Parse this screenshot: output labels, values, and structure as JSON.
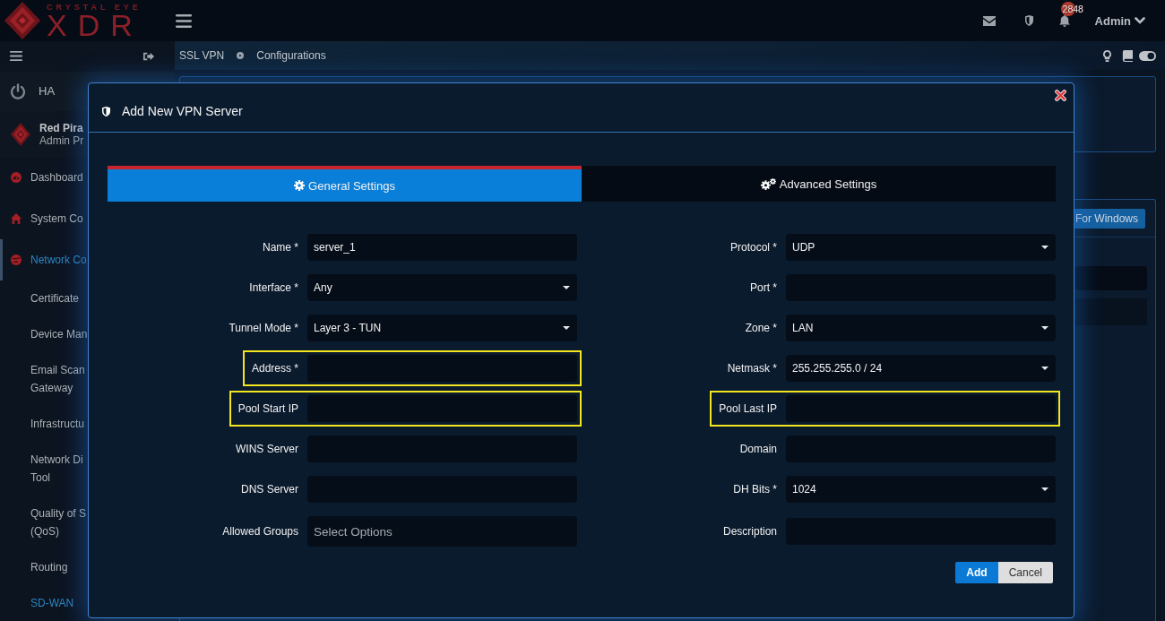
{
  "top_bar": {
    "logo": {
      "tagline": "CRYSTAL EYE",
      "wordmark": "XDR"
    },
    "notification_count": "2848",
    "user": "Admin"
  },
  "sidebar": {
    "status_item": "HA",
    "profile": {
      "name": "Red Pira",
      "role": "Admin Pr"
    },
    "items": [
      {
        "label": "Dashboard",
        "selected": false
      },
      {
        "label": "System Co",
        "selected": false
      },
      {
        "label": "Network Co",
        "selected": true,
        "children": [
          {
            "label": "Certificate",
            "selected": false
          },
          {
            "label": "Device Man",
            "selected": false
          },
          {
            "label": "Email Scan\nGateway",
            "selected": false
          },
          {
            "label": "Infrastructu",
            "selected": false
          },
          {
            "label": "Network Di\nTool",
            "selected": false
          },
          {
            "label": "Quality of S\n(QoS)",
            "selected": false
          },
          {
            "label": "Routing",
            "selected": false
          },
          {
            "label": "SD-WAN",
            "selected": true
          }
        ]
      }
    ]
  },
  "breadcrumb": [
    "SSL VPN",
    "Configurations"
  ],
  "page": {
    "download_button": "For Windows"
  },
  "modal": {
    "title": "Add New VPN Server",
    "tabs": [
      {
        "label": "General Settings",
        "selected": true
      },
      {
        "label": "Advanced Settings",
        "selected": false
      }
    ],
    "form": {
      "left_column": [
        {
          "label": "Name *",
          "kind": "text",
          "value": "server_1",
          "highlighted": false
        },
        {
          "label": "Interface *",
          "kind": "select",
          "value": "Any",
          "highlighted": false
        },
        {
          "label": "Tunnel Mode *",
          "kind": "select",
          "value": "Layer 3 - TUN",
          "highlighted": false
        },
        {
          "label": "Address *",
          "kind": "text",
          "highlighted": true
        },
        {
          "label": "Pool Start IP",
          "kind": "text",
          "highlighted": true
        },
        {
          "label": "WINS Server",
          "kind": "text",
          "highlighted": false
        },
        {
          "label": "DNS Server",
          "kind": "text",
          "highlighted": false
        },
        {
          "label": "Allowed Groups",
          "kind": "multiselect",
          "placeholder": "Select Options",
          "highlighted": false
        }
      ],
      "right_column": [
        {
          "label": "Protocol *",
          "kind": "select",
          "value": "UDP",
          "highlighted": false
        },
        {
          "label": "Port *",
          "kind": "text",
          "highlighted": false
        },
        {
          "label": "Zone *",
          "kind": "select",
          "value": "LAN",
          "highlighted": false
        },
        {
          "label": "Netmask *",
          "kind": "select",
          "value": "255.255.255.0 / 24",
          "highlighted": false
        },
        {
          "label": "Pool Last IP",
          "kind": "text",
          "highlighted": true
        },
        {
          "label": "Domain",
          "kind": "text",
          "highlighted": false
        },
        {
          "label": "DH Bits *",
          "kind": "select",
          "value": "1024",
          "highlighted": false
        },
        {
          "label": "Description",
          "kind": "text",
          "highlighted": false
        }
      ]
    },
    "buttons": [
      {
        "label": "Add",
        "kind": "submit"
      },
      {
        "label": "Cancel",
        "kind": "cancel"
      }
    ]
  }
}
